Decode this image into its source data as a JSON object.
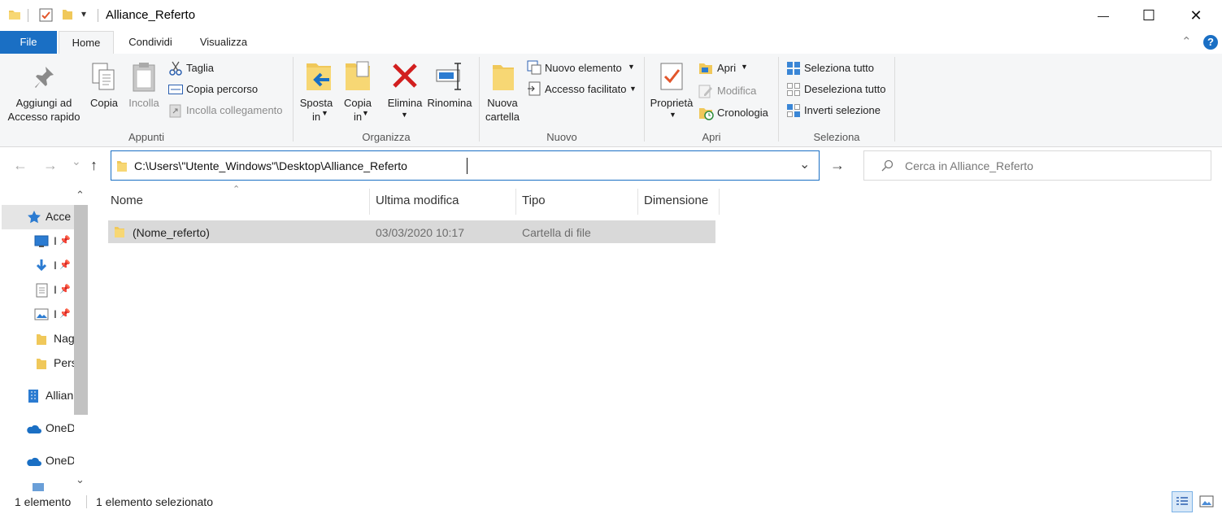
{
  "window": {
    "title": "Alliance_Referto",
    "minimize_glyph": "—",
    "maximize_glyph": "☐",
    "close_glyph": "✕",
    "qat_dropdown_glyph": "▾"
  },
  "ribbon_tabs": [
    {
      "label": "File"
    },
    {
      "label": "Home"
    },
    {
      "label": "Condividi"
    },
    {
      "label": "Visualizza"
    }
  ],
  "ribbon": {
    "collapse_glyph": "⌃",
    "help_glyph": "?",
    "groups": {
      "appunti": {
        "label": "Appunti",
        "pin_label": "Aggiungi ad\nAccesso rapido",
        "copy_label": "Copia",
        "paste_label": "Incolla",
        "cut_label": "Taglia",
        "copy_path_label": "Copia percorso",
        "paste_link_label": "Incolla collegamento"
      },
      "organizza": {
        "label": "Organizza",
        "move_label": "Sposta\nin",
        "copy_to_label": "Copia\nin",
        "delete_label": "Elimina",
        "rename_label": "Rinomina"
      },
      "nuovo": {
        "label": "Nuovo",
        "new_folder_label": "Nuova\ncartella",
        "new_item_label": "Nuovo elemento",
        "easy_access_label": "Accesso facilitato"
      },
      "apri": {
        "label": "Apri",
        "properties_label": "Proprietà",
        "open_label": "Apri",
        "edit_label": "Modifica",
        "history_label": "Cronologia"
      },
      "seleziona": {
        "label": "Seleziona",
        "select_all_label": "Seleziona tutto",
        "select_none_label": "Deseleziona tutto",
        "invert_label": "Inverti selezione"
      }
    }
  },
  "address": {
    "back_glyph": "←",
    "forward_glyph": "→",
    "recent_glyph": "⌄",
    "up_glyph": "↑",
    "path": "C:\\Users\\\"Utente_Windows\"\\Desktop\\Alliance_Referto",
    "dropdown_glyph": "⌄",
    "go_glyph": "→",
    "search_placeholder": "Cerca in Alliance_Referto"
  },
  "columns": [
    "Nome",
    "Ultima modifica",
    "Tipo",
    "Dimensione"
  ],
  "files": [
    {
      "name": "(Nome_referto)",
      "modified": "03/03/2020 10:17",
      "type": "Cartella di file",
      "size": ""
    }
  ],
  "nav_pane": {
    "items": [
      "Acce",
      "I",
      "I",
      "I",
      "I",
      "Nag",
      "Pers",
      "Allian",
      "OneD",
      "OneD"
    ],
    "scroll_up_glyph": "⌃",
    "scroll_down_glyph": "⌄"
  },
  "status": {
    "count": "1 elemento",
    "selected": "1 elemento selezionato"
  },
  "colors": {
    "accent": "#1a6fc4",
    "selection": "#d9d9d9",
    "folder": "#f0c85a",
    "delete_red": "#d21f1f"
  }
}
